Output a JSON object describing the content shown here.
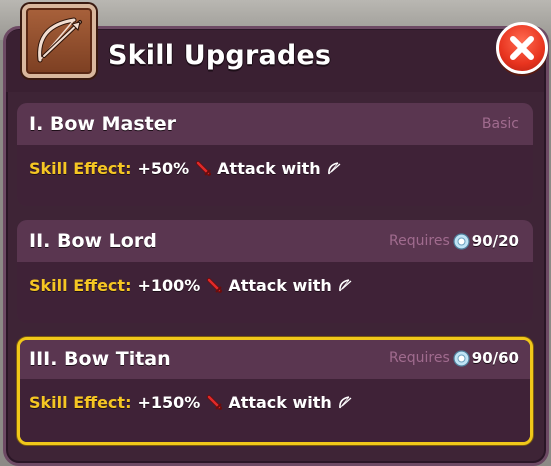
{
  "dialog": {
    "title": "Skill Upgrades",
    "icon": "bow-icon",
    "close_icon": "close-icon"
  },
  "effect_label": "Skill Effect:",
  "attack_text": "Attack with",
  "requires_label": "Requires",
  "cards": [
    {
      "name": "I. Bow Master",
      "tier": "Basic",
      "effect_value": "+50%",
      "requirement": "",
      "selected": false
    },
    {
      "name": "II. Bow Lord",
      "tier": "",
      "effect_value": "+100%",
      "requirement": "90/20",
      "selected": false
    },
    {
      "name": "III. Bow Titan",
      "tier": "",
      "effect_value": "+150%",
      "requirement": "90/60",
      "selected": true
    }
  ],
  "colors": {
    "panel": "#3e2436",
    "effect_label": "#f5c623",
    "highlight_border": "#f0c81a",
    "close_button": "#e8341f"
  }
}
